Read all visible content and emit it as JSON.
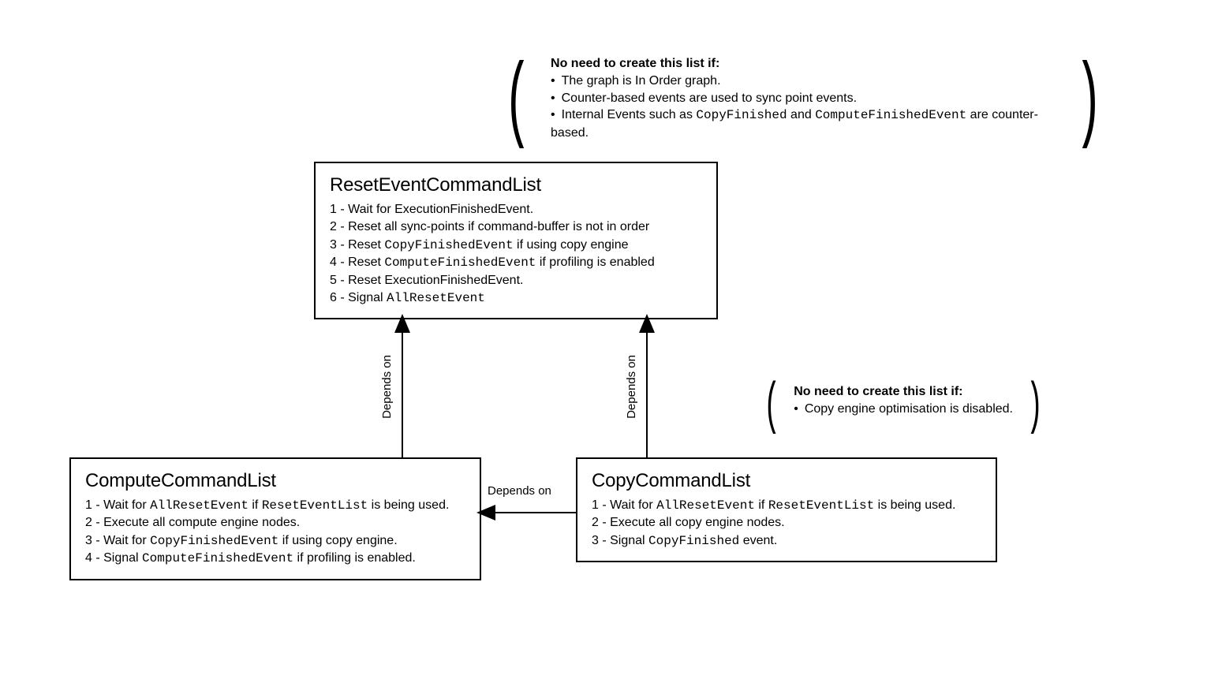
{
  "top_annot": {
    "title": "No need to create this list if:",
    "items": [
      {
        "pre": "The graph is In Order graph."
      },
      {
        "pre": "Counter-based events are used to sync point events."
      },
      {
        "pre": "Internal Events such as ",
        "code1": "CopyFinished",
        "mid": " and ",
        "code2": "ComputeFinishedEvent",
        "post": " are counter-based."
      }
    ]
  },
  "right_annot": {
    "title": "No need to create this list if:",
    "items": [
      {
        "pre": "Copy engine optimisation is disabled."
      }
    ]
  },
  "reset": {
    "title": "ResetEventCommandList",
    "steps": [
      {
        "n": "1",
        "pre": "Wait for ExecutionFinishedEvent."
      },
      {
        "n": "2",
        "pre": "Reset all sync-points if command-buffer is not in order"
      },
      {
        "n": "3",
        "pre": "Reset ",
        "c1": "CopyFinishedEvent",
        "post": " if using copy engine"
      },
      {
        "n": "4",
        "pre": "Reset ",
        "c1": "ComputeFinishedEvent",
        "post": " if profiling is enabled"
      },
      {
        "n": "5",
        "pre": "Reset ExecutionFinishedEvent."
      },
      {
        "n": "6",
        "pre": "Signal ",
        "c1": "AllResetEvent"
      }
    ]
  },
  "compute": {
    "title": "ComputeCommandList",
    "steps": [
      {
        "n": "1",
        "pre": "Wait for ",
        "c1": "AllResetEvent",
        "mid": " if ",
        "c2": "ResetEventList",
        "post": " is being used."
      },
      {
        "n": "2",
        "pre": "Execute all compute engine nodes."
      },
      {
        "n": "3",
        "pre": "Wait for ",
        "c1": "CopyFinishedEvent",
        "post": " if using copy engine."
      },
      {
        "n": "4",
        "pre": "Signal ",
        "c1": "ComputeFinishedEvent",
        "post": " if profiling is enabled."
      }
    ]
  },
  "copy": {
    "title": "CopyCommandList",
    "steps": [
      {
        "n": "1",
        "pre": "Wait for ",
        "c1": "AllResetEvent",
        "mid": " if ",
        "c2": "ResetEventList",
        "post": " is being used."
      },
      {
        "n": "2",
        "pre": "Execute all copy engine nodes."
      },
      {
        "n": "3",
        "pre": "Signal ",
        "c1": "CopyFinished",
        "post": " event."
      }
    ]
  },
  "edge_labels": {
    "compute_to_reset": "Depends on",
    "copy_to_reset": "Depends on",
    "copy_to_compute": "Depends on"
  }
}
